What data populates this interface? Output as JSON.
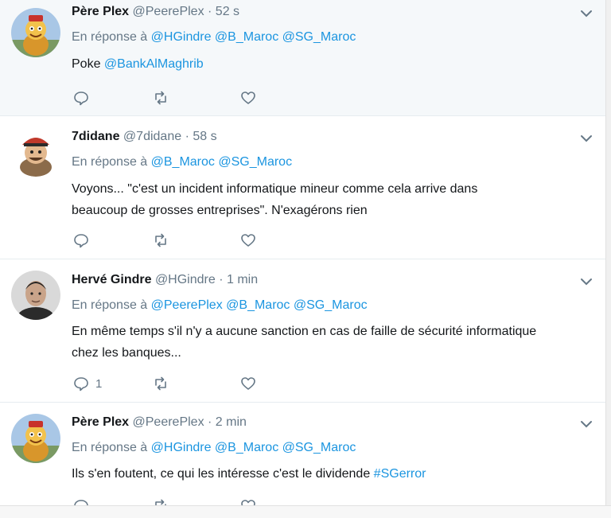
{
  "tweets": [
    {
      "name": "Père Plex",
      "handle": "@PeerePlex",
      "time": "· 52 s",
      "reply_prefix": "En réponse à",
      "reply_to": [
        "@HGindre",
        "@B_Maroc",
        "@SG_Maroc"
      ],
      "text_before": "Poke",
      "text_link": "@BankAlMaghrib",
      "text_after": "",
      "reply_count": "",
      "avatar": "pere-plex-avatar"
    },
    {
      "name": "7didane",
      "handle": "@7didane",
      "time": "· 58 s",
      "reply_prefix": "En réponse à",
      "reply_to": [
        "@B_Maroc",
        "@SG_Maroc"
      ],
      "text_line1": "Voyons... \"c'est un incident informatique mineur comme cela arrive dans",
      "text_line2": "beaucoup de grosses entreprises\". N'exagérons rien",
      "reply_count": "",
      "avatar": "pirate-avatar"
    },
    {
      "name": "Hervé Gindre",
      "handle": "@HGindre",
      "time": "· 1 min",
      "reply_prefix": "En réponse à",
      "reply_to": [
        "@PeerePlex",
        "@B_Maroc",
        "@SG_Maroc"
      ],
      "text_line1": "En même temps s'il n'y a aucune sanction en cas de faille de sécurité informatique",
      "text_line2": "chez les banques...",
      "reply_count": "1",
      "avatar": "person-avatar"
    },
    {
      "name": "Père Plex",
      "handle": "@PeerePlex",
      "time": "· 2 min",
      "reply_prefix": "En réponse à",
      "reply_to": [
        "@HGindre",
        "@B_Maroc",
        "@SG_Maroc"
      ],
      "text_before": "Ils s'en foutent, ce qui les intéresse c'est le dividende",
      "text_link": "#SGerror",
      "text_after": "",
      "reply_count": "",
      "avatar": "pere-plex-avatar"
    }
  ],
  "icons": {
    "reply": "speech-bubble-icon",
    "retweet": "retweet-icon",
    "like": "heart-icon",
    "menu": "chevron-down-icon"
  },
  "colors": {
    "link": "#1b95e0",
    "muted": "#657786",
    "highlight_bg": "#f5f8fa"
  }
}
